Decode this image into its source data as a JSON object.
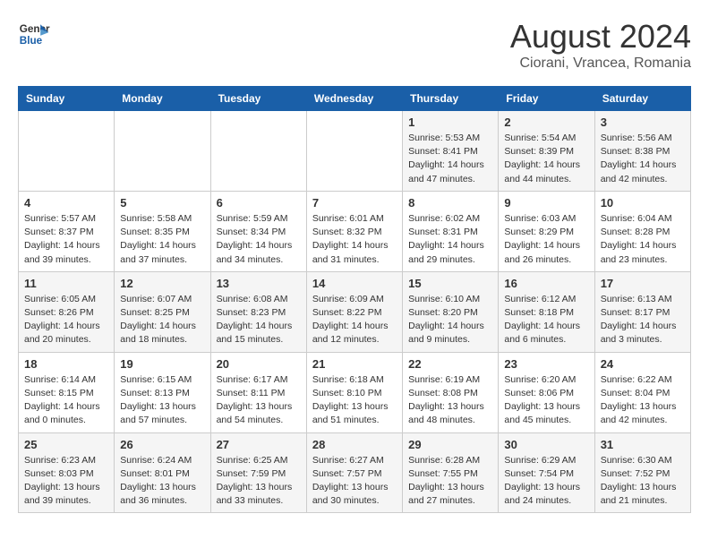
{
  "header": {
    "logo_general": "General",
    "logo_blue": "Blue",
    "month_title": "August 2024",
    "subtitle": "Ciorani, Vrancea, Romania"
  },
  "calendar": {
    "weekdays": [
      "Sunday",
      "Monday",
      "Tuesday",
      "Wednesday",
      "Thursday",
      "Friday",
      "Saturday"
    ],
    "weeks": [
      [
        {
          "day": "",
          "info": ""
        },
        {
          "day": "",
          "info": ""
        },
        {
          "day": "",
          "info": ""
        },
        {
          "day": "",
          "info": ""
        },
        {
          "day": "1",
          "info": "Sunrise: 5:53 AM\nSunset: 8:41 PM\nDaylight: 14 hours\nand 47 minutes."
        },
        {
          "day": "2",
          "info": "Sunrise: 5:54 AM\nSunset: 8:39 PM\nDaylight: 14 hours\nand 44 minutes."
        },
        {
          "day": "3",
          "info": "Sunrise: 5:56 AM\nSunset: 8:38 PM\nDaylight: 14 hours\nand 42 minutes."
        }
      ],
      [
        {
          "day": "4",
          "info": "Sunrise: 5:57 AM\nSunset: 8:37 PM\nDaylight: 14 hours\nand 39 minutes."
        },
        {
          "day": "5",
          "info": "Sunrise: 5:58 AM\nSunset: 8:35 PM\nDaylight: 14 hours\nand 37 minutes."
        },
        {
          "day": "6",
          "info": "Sunrise: 5:59 AM\nSunset: 8:34 PM\nDaylight: 14 hours\nand 34 minutes."
        },
        {
          "day": "7",
          "info": "Sunrise: 6:01 AM\nSunset: 8:32 PM\nDaylight: 14 hours\nand 31 minutes."
        },
        {
          "day": "8",
          "info": "Sunrise: 6:02 AM\nSunset: 8:31 PM\nDaylight: 14 hours\nand 29 minutes."
        },
        {
          "day": "9",
          "info": "Sunrise: 6:03 AM\nSunset: 8:29 PM\nDaylight: 14 hours\nand 26 minutes."
        },
        {
          "day": "10",
          "info": "Sunrise: 6:04 AM\nSunset: 8:28 PM\nDaylight: 14 hours\nand 23 minutes."
        }
      ],
      [
        {
          "day": "11",
          "info": "Sunrise: 6:05 AM\nSunset: 8:26 PM\nDaylight: 14 hours\nand 20 minutes."
        },
        {
          "day": "12",
          "info": "Sunrise: 6:07 AM\nSunset: 8:25 PM\nDaylight: 14 hours\nand 18 minutes."
        },
        {
          "day": "13",
          "info": "Sunrise: 6:08 AM\nSunset: 8:23 PM\nDaylight: 14 hours\nand 15 minutes."
        },
        {
          "day": "14",
          "info": "Sunrise: 6:09 AM\nSunset: 8:22 PM\nDaylight: 14 hours\nand 12 minutes."
        },
        {
          "day": "15",
          "info": "Sunrise: 6:10 AM\nSunset: 8:20 PM\nDaylight: 14 hours\nand 9 minutes."
        },
        {
          "day": "16",
          "info": "Sunrise: 6:12 AM\nSunset: 8:18 PM\nDaylight: 14 hours\nand 6 minutes."
        },
        {
          "day": "17",
          "info": "Sunrise: 6:13 AM\nSunset: 8:17 PM\nDaylight: 14 hours\nand 3 minutes."
        }
      ],
      [
        {
          "day": "18",
          "info": "Sunrise: 6:14 AM\nSunset: 8:15 PM\nDaylight: 14 hours\nand 0 minutes."
        },
        {
          "day": "19",
          "info": "Sunrise: 6:15 AM\nSunset: 8:13 PM\nDaylight: 13 hours\nand 57 minutes."
        },
        {
          "day": "20",
          "info": "Sunrise: 6:17 AM\nSunset: 8:11 PM\nDaylight: 13 hours\nand 54 minutes."
        },
        {
          "day": "21",
          "info": "Sunrise: 6:18 AM\nSunset: 8:10 PM\nDaylight: 13 hours\nand 51 minutes."
        },
        {
          "day": "22",
          "info": "Sunrise: 6:19 AM\nSunset: 8:08 PM\nDaylight: 13 hours\nand 48 minutes."
        },
        {
          "day": "23",
          "info": "Sunrise: 6:20 AM\nSunset: 8:06 PM\nDaylight: 13 hours\nand 45 minutes."
        },
        {
          "day": "24",
          "info": "Sunrise: 6:22 AM\nSunset: 8:04 PM\nDaylight: 13 hours\nand 42 minutes."
        }
      ],
      [
        {
          "day": "25",
          "info": "Sunrise: 6:23 AM\nSunset: 8:03 PM\nDaylight: 13 hours\nand 39 minutes."
        },
        {
          "day": "26",
          "info": "Sunrise: 6:24 AM\nSunset: 8:01 PM\nDaylight: 13 hours\nand 36 minutes."
        },
        {
          "day": "27",
          "info": "Sunrise: 6:25 AM\nSunset: 7:59 PM\nDaylight: 13 hours\nand 33 minutes."
        },
        {
          "day": "28",
          "info": "Sunrise: 6:27 AM\nSunset: 7:57 PM\nDaylight: 13 hours\nand 30 minutes."
        },
        {
          "day": "29",
          "info": "Sunrise: 6:28 AM\nSunset: 7:55 PM\nDaylight: 13 hours\nand 27 minutes."
        },
        {
          "day": "30",
          "info": "Sunrise: 6:29 AM\nSunset: 7:54 PM\nDaylight: 13 hours\nand 24 minutes."
        },
        {
          "day": "31",
          "info": "Sunrise: 6:30 AM\nSunset: 7:52 PM\nDaylight: 13 hours\nand 21 minutes."
        }
      ]
    ]
  }
}
